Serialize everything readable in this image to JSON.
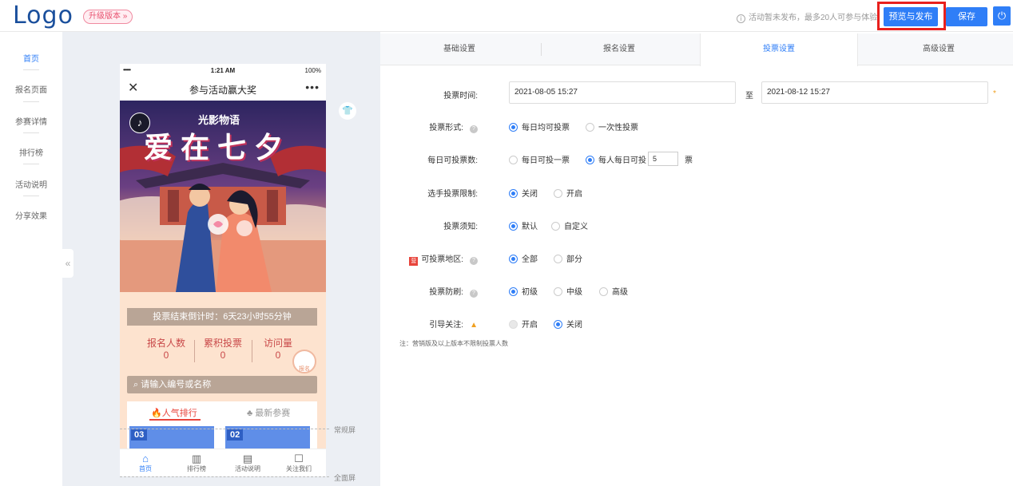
{
  "header": {
    "logo": "Logo",
    "upgrade_label": "升级版本 »",
    "notice_text": "活动暂未发布，最多20人可参与体验",
    "preview_label": "预览与发布",
    "save_label": "保存",
    "power_icon": "⏻"
  },
  "sidebar": {
    "items": [
      {
        "label": "首页",
        "active": true
      },
      {
        "label": "报名页面"
      },
      {
        "label": "参赛详情"
      },
      {
        "label": "排行榜"
      },
      {
        "label": "活动说明"
      },
      {
        "label": "分享效果"
      }
    ]
  },
  "phone": {
    "status": {
      "signal": "•••••",
      "time": "1:21 AM",
      "battery": "100%"
    },
    "nav_title": "参与活动赢大奖",
    "banner_subtitle": "光影物语",
    "banner_title": "爱在七夕",
    "countdown": "投票结束倒计时：6天23小时55分钟",
    "stats": [
      {
        "label": "报名人数",
        "value": "0"
      },
      {
        "label": "累积投票",
        "value": "0"
      },
      {
        "label": "访问量",
        "value": "0"
      }
    ],
    "enroll_label": "报名",
    "search_placeholder": "请输入编号或名称",
    "tab_popular": "人气排行",
    "tab_latest": "最新参赛",
    "cards": [
      "03",
      "02"
    ],
    "tabbar": [
      {
        "label": "首页",
        "icon": "home-icon",
        "active": true
      },
      {
        "label": "排行榜",
        "icon": "bar-chart-icon"
      },
      {
        "label": "活动说明",
        "icon": "document-icon"
      },
      {
        "label": "关注我们",
        "icon": "follow-icon"
      }
    ]
  },
  "canvas_markers": {
    "normal": "常规屏",
    "full": "全面屏"
  },
  "settings": {
    "tabs": [
      {
        "label": "基础设置"
      },
      {
        "label": "报名设置"
      },
      {
        "label": "投票设置",
        "active": true
      },
      {
        "label": "高级设置"
      }
    ],
    "vote_time": {
      "label": "投票时间:",
      "start": "2021-08-05 15:27",
      "sep": "至",
      "end": "2021-08-12 15:27",
      "required_mark": "*"
    },
    "vote_form": {
      "label": "投票形式:",
      "options": [
        "每日均可投票",
        "一次性投票"
      ],
      "selected": 0
    },
    "daily_votes": {
      "label": "每日可投票数:",
      "options": [
        "每日可投一票",
        "每人每日可投"
      ],
      "selected": 1,
      "count": "5",
      "unit": "票"
    },
    "contestant_limit": {
      "label": "选手投票限制:",
      "options": [
        "关闭",
        "开启"
      ],
      "selected": 0
    },
    "vote_notice": {
      "label": "投票须知:",
      "options": [
        "默认",
        "自定义"
      ],
      "selected": 0
    },
    "vote_region": {
      "label": "可投票地区:",
      "options": [
        "全部",
        "部分"
      ],
      "selected": 0,
      "tag": "营"
    },
    "anti_fraud": {
      "label": "投票防刷:",
      "options": [
        "初级",
        "中级",
        "高级"
      ],
      "selected": 0
    },
    "guide_follow": {
      "label": "引导关注:",
      "options": [
        "开启",
        "关闭"
      ],
      "selected": 1
    },
    "note": "注：营销版及以上版本不限制投票人数"
  }
}
